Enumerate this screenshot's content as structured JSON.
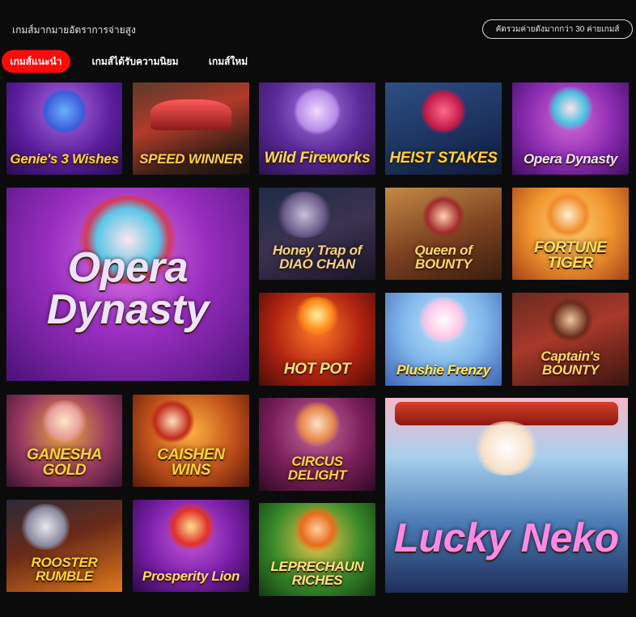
{
  "header": {
    "title": "เกมส์มากมายอัตราการจ่ายสูง",
    "promo_label": "คัดรวมค่ายดังมากกว่า 30 ค่ายเกมส์"
  },
  "tabs": [
    {
      "label": "เกมส์แนะนำ",
      "active": true
    },
    {
      "label": "เกมส์ได้รับความนิยม",
      "active": false
    },
    {
      "label": "เกมส์ใหม่",
      "active": false
    }
  ],
  "colors": {
    "page_background": "#0b0b0c",
    "active_tab": "#ff0a0a",
    "text": "#ffffff"
  },
  "games": [
    {
      "title": "Genie's 3 Wishes",
      "title_color": "#ffd23a",
      "size": "sz-s"
    },
    {
      "title": "SPEED WINNER",
      "title_color": "#ffcf4a",
      "size": "sz-s"
    },
    {
      "title": "Wild Fireworks",
      "title_color": "#ffd84a",
      "size": "sz-m"
    },
    {
      "title": "HEIST STAKES",
      "title_color": "#ffd23a",
      "size": "sz-m"
    },
    {
      "title": "Opera Dynasty",
      "title_color": "#efe2ff",
      "size": "sz-s"
    },
    {
      "title": "Opera Dynasty",
      "title_color": "#efe2ff",
      "size": "sz-xl"
    },
    {
      "title": "Honey Trap of DIAO CHAN",
      "title_color": "#f0d28a",
      "size": "sz-s"
    },
    {
      "title": "Queen of BOUNTY",
      "title_color": "#ffd86a",
      "size": "sz-s"
    },
    {
      "title": "FORTUNE TIGER",
      "title_color": "#ffdf5a",
      "size": "sz-m"
    },
    {
      "title": "HOT POT",
      "title_color": "#ffe07a",
      "size": "sz-m"
    },
    {
      "title": "Plushie Frenzy",
      "title_color": "#ffe85a",
      "size": "sz-s"
    },
    {
      "title": "Captain's BOUNTY",
      "title_color": "#ffd86a",
      "size": "sz-s"
    },
    {
      "title": "GANESHA GOLD",
      "title_color": "#ffd23a",
      "size": "sz-m"
    },
    {
      "title": "CAISHEN WINS",
      "title_color": "#ffd23a",
      "size": "sz-m"
    },
    {
      "title": "CIRCUS DELIGHT",
      "title_color": "#ffcf4a",
      "size": "sz-s"
    },
    {
      "title": "Lucky Neko",
      "title_color": "#ff8ae6",
      "size": "sz-l"
    },
    {
      "title": "ROOSTER RUMBLE",
      "title_color": "#ffd23a",
      "size": "sz-s"
    },
    {
      "title": "Prosperity Lion",
      "title_color": "#ffd86a",
      "size": "sz-s"
    },
    {
      "title": "LEPRECHAUN RICHES",
      "title_color": "#ffe07a",
      "size": "sz-s"
    }
  ]
}
